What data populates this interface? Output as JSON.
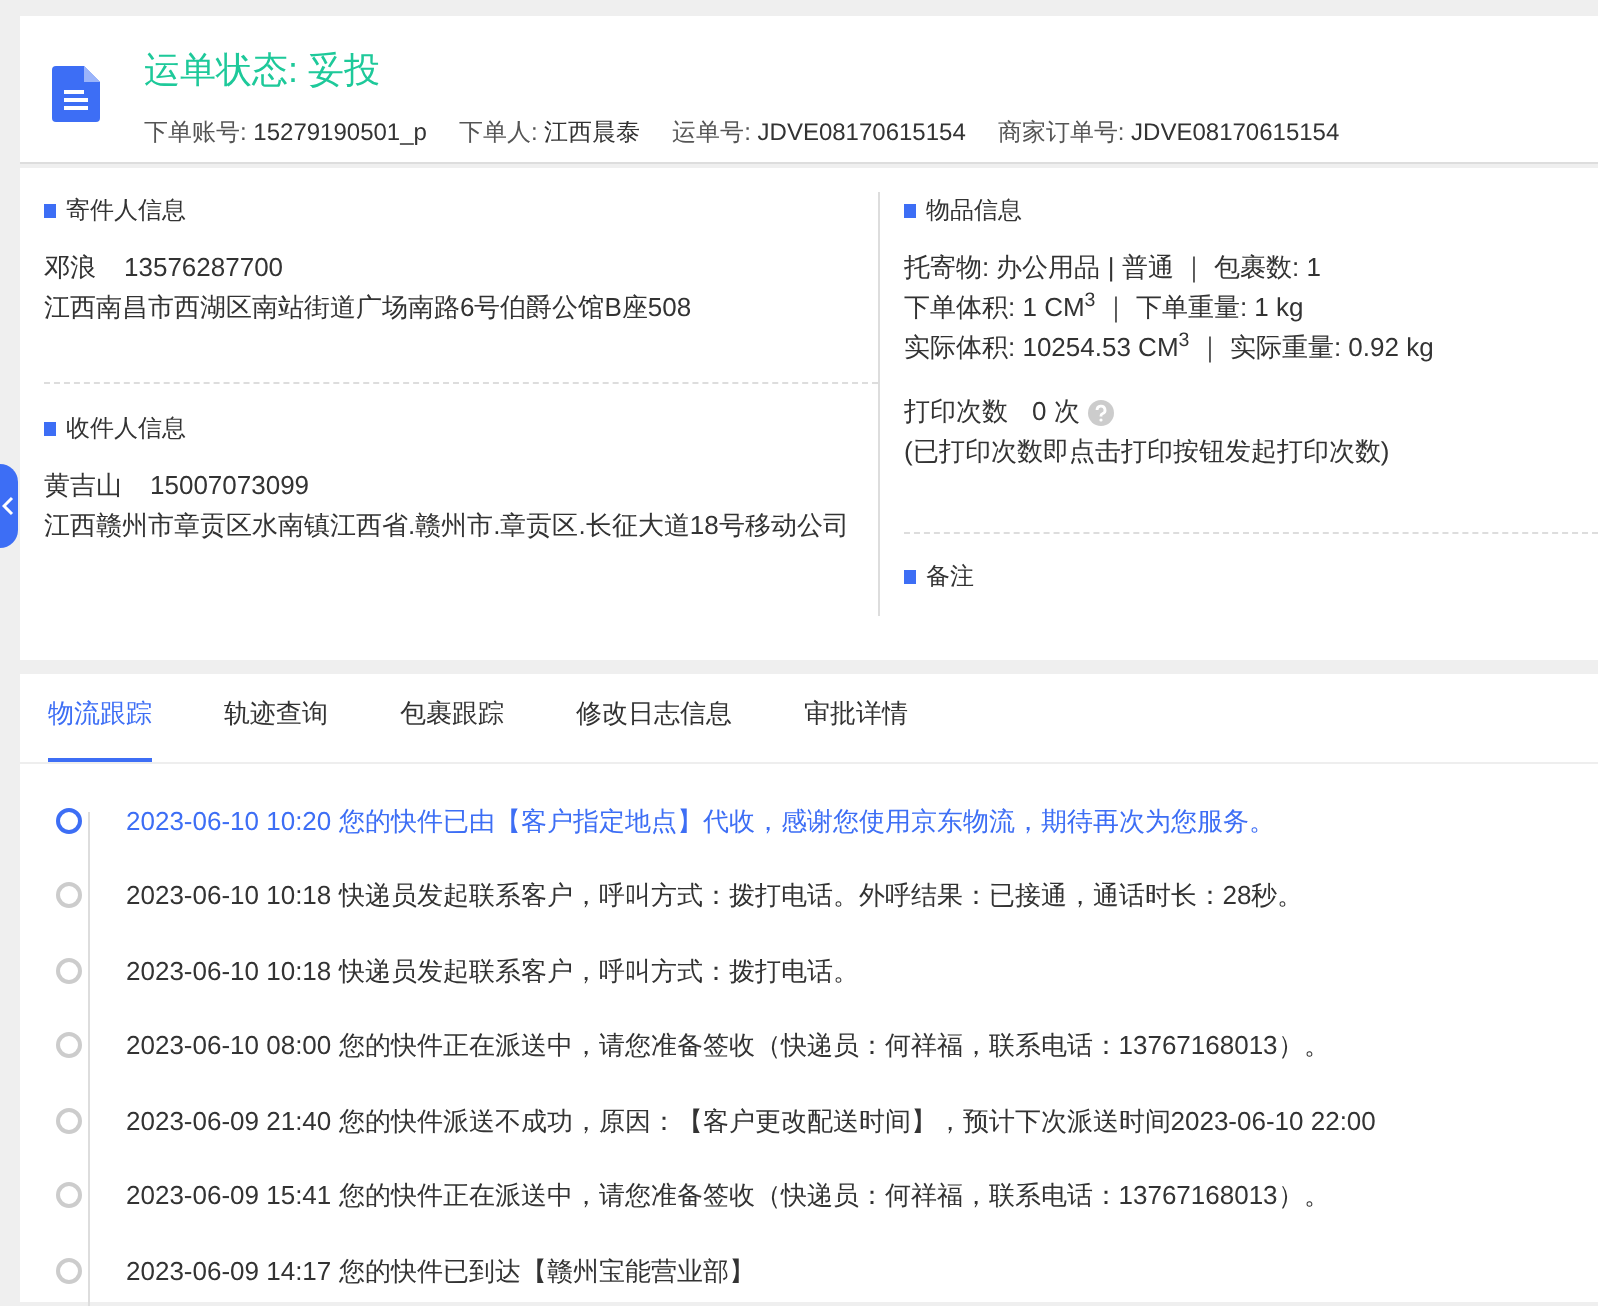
{
  "header": {
    "status_title": "运单状态: 妥投",
    "meta": [
      {
        "label": "下单账号:",
        "value": "15279190501_p"
      },
      {
        "label": "下单人:",
        "value": "江西晨泰"
      },
      {
        "label": "运单号:",
        "value": "JDVE08170615154"
      },
      {
        "label": "商家订单号:",
        "value": "JDVE08170615154"
      }
    ]
  },
  "sender": {
    "title": "寄件人信息",
    "name": "邓浪",
    "phone": "13576287700",
    "address": "江西南昌市西湖区南站街道广场南路6号伯爵公馆B座508"
  },
  "receiver": {
    "title": "收件人信息",
    "name": "黄吉山",
    "phone": "15007073099",
    "address": "江西赣州市章贡区水南镇江西省.赣州市.章贡区.长征大道18号移动公司"
  },
  "goods": {
    "title": "物品信息",
    "lines": [
      "托寄物:  办公用品 | 普通 ｜ 包裹数:  1",
      "下单体积:   1 CM$^{3}$ ｜ 下单重量:  1 kg",
      "实际体积:   10254.53 CM$^{3}$ ｜ 实际重量:  0.92 kg"
    ],
    "print_count_label": "打印次数",
    "print_count_value": "0 次",
    "print_note": "(已打印次数即点击打印按钮发起打印次数)"
  },
  "remarks": {
    "title": "备注"
  },
  "tabs": [
    {
      "label": "物流跟踪",
      "selected": true
    },
    {
      "label": "轨迹查询",
      "selected": false
    },
    {
      "label": "包裹跟踪",
      "selected": false
    },
    {
      "label": "修改日志信息",
      "selected": false
    },
    {
      "label": "审批详情",
      "selected": false
    }
  ],
  "timeline": [
    {
      "text": "2023-06-10 10:20 您的快件已由【客户指定地点】代收，感谢您使用京东物流，期待再次为您服务。",
      "current": true
    },
    {
      "text": "2023-06-10 10:18 快递员发起联系客户，呼叫方式：拨打电话。外呼结果：已接通，通话时长：28秒。",
      "current": false
    },
    {
      "text": "2023-06-10 10:18 快递员发起联系客户，呼叫方式：拨打电话。",
      "current": false
    },
    {
      "text": "2023-06-10 08:00 您的快件正在派送中，请您准备签收（快递员：何祥福，联系电话：13767168013）。",
      "current": false
    },
    {
      "text": "2023-06-09 21:40 您的快件派送不成功，原因：【客户更改配送时间】，预计下次派送时间2023-06-10 22:00",
      "current": false
    },
    {
      "text": "2023-06-09 15:41 您的快件正在派送中，请您准备签收（快递员：何祥福，联系电话：13767168013）。",
      "current": false
    },
    {
      "text": "2023-06-09 14:17 您的快件已到达【赣州宝能营业部】",
      "current": false
    }
  ]
}
